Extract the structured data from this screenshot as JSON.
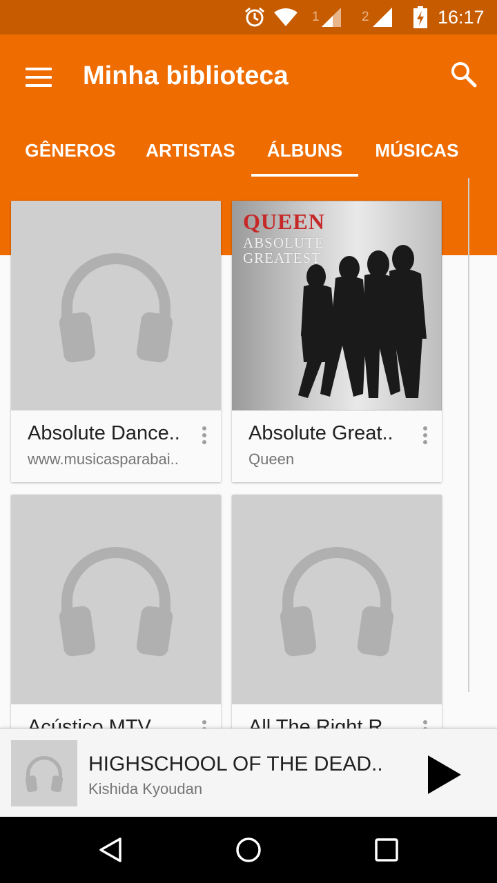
{
  "status_bar": {
    "time": "16:17",
    "sim1_label": "1",
    "sim2_label": "2",
    "icons": [
      "alarm-icon",
      "wifi-icon",
      "signal-sim1-icon",
      "signal-sim2-icon",
      "battery-charging-icon"
    ]
  },
  "app_bar": {
    "title": "Minha biblioteca",
    "menu_icon": "menu-icon",
    "search_icon": "search-icon",
    "color": "#ef6c00"
  },
  "tabs": [
    {
      "label": "GÊNEROS",
      "active": false
    },
    {
      "label": "ARTISTAS",
      "active": false
    },
    {
      "label": "ÁLBUNS",
      "active": true
    },
    {
      "label": "MÚSICAS",
      "active": false
    }
  ],
  "albums": [
    {
      "title": "Absolute Dance..",
      "subtitle": "www.musicasparabai..",
      "art": "headphones-placeholder-icon"
    },
    {
      "title": "Absolute Great..",
      "subtitle": "Queen",
      "art": "album-cover",
      "cover_band": "QUEEN",
      "cover_line1": "ABSOLUTE",
      "cover_line2": "GREATEST"
    },
    {
      "title": "Acústico MTV",
      "subtitle": "",
      "art": "headphones-placeholder-icon"
    },
    {
      "title": "All The Right R..",
      "subtitle": "",
      "art": "headphones-placeholder-icon"
    }
  ],
  "now_playing": {
    "title": "HIGHSCHOOL OF THE DEAD..",
    "artist": "Kishida Kyoudan",
    "art": "headphones-placeholder-icon",
    "play_icon": "play-icon"
  },
  "nav_bar": {
    "icons": [
      "back-icon",
      "home-icon",
      "recents-icon"
    ]
  }
}
